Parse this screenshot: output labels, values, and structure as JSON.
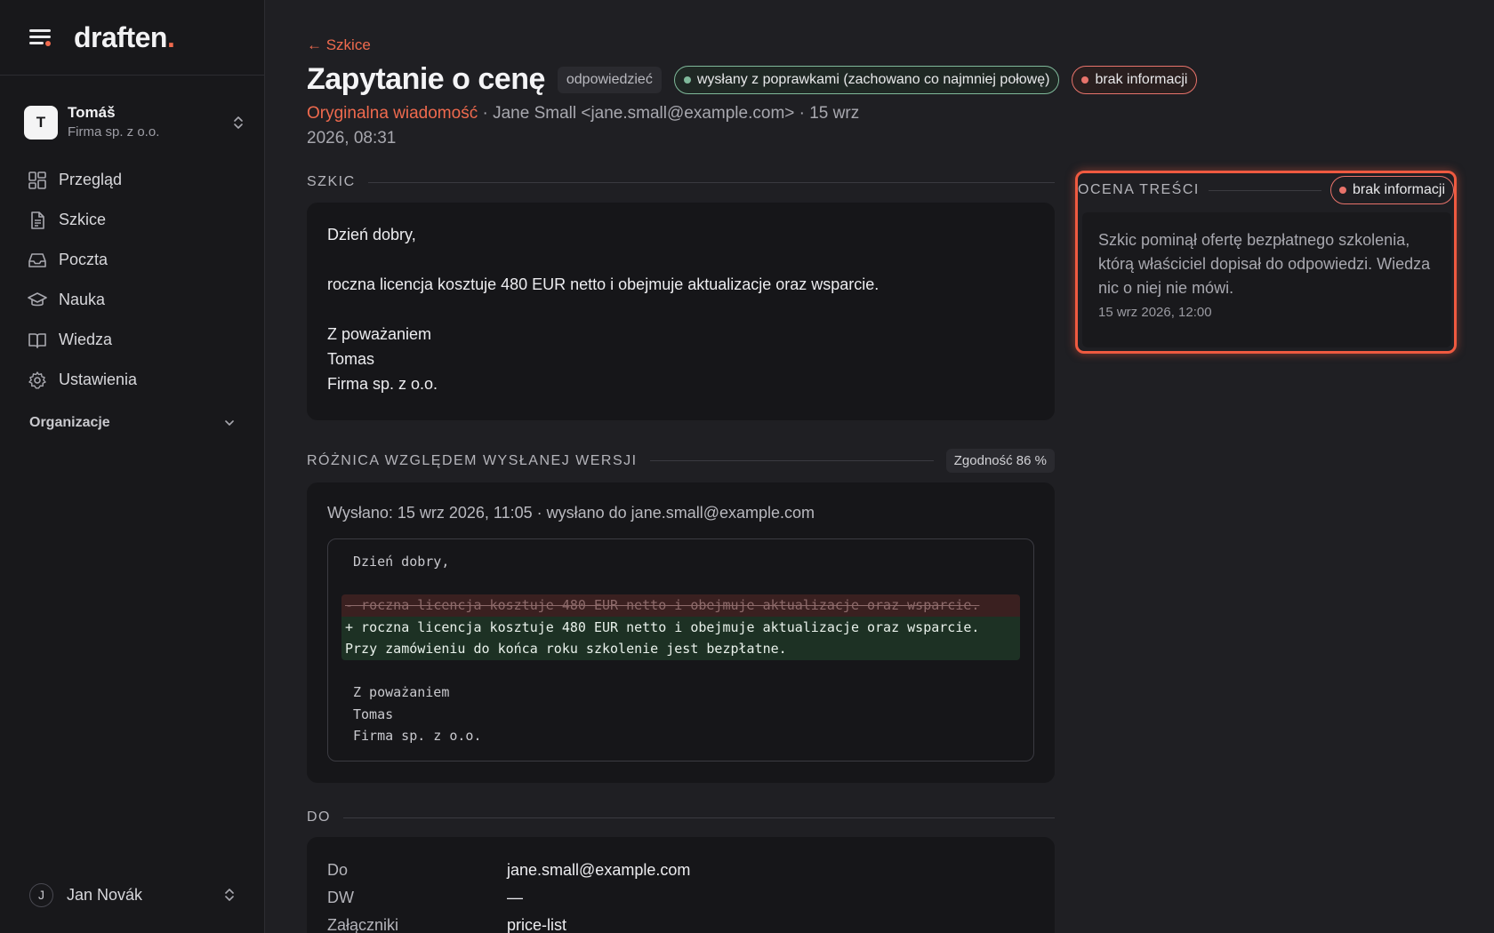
{
  "app": {
    "logo_text": "draften",
    "logo_dot": ".",
    "accent_color": "#ef6a4e"
  },
  "account": {
    "initial": "T",
    "name": "Tomáš",
    "org": "Firma sp. z o.o."
  },
  "sidebar": {
    "items": [
      {
        "label": "Przegląd",
        "icon": "grid-icon"
      },
      {
        "label": "Szkice",
        "icon": "document-icon"
      },
      {
        "label": "Poczta",
        "icon": "inbox-icon"
      },
      {
        "label": "Nauka",
        "icon": "graduation-cap-icon"
      },
      {
        "label": "Wiedza",
        "icon": "book-icon"
      },
      {
        "label": "Ustawienia",
        "icon": "gear-icon"
      }
    ],
    "organizations_label": "Organizacje"
  },
  "user": {
    "initial": "J",
    "name": "Jan Novák"
  },
  "header": {
    "back_label": "← Szkice",
    "title": "Zapytanie o cenę",
    "tag_type": "odpowiedzieć",
    "status_pill": "wysłany z poprawkami (zachowano co najmniej połowę)",
    "status_color": "#7fb99a",
    "info_pill": "brak informacji",
    "info_color": "#e8736b",
    "meta_original": "Oryginalna wiadomość",
    "meta_rest": " · Jane Small <jane.small@example.com> · 15 wrz 2026, 08:31"
  },
  "draft": {
    "section_title": "SZKIC",
    "lines": [
      "Dzień dobry,",
      "",
      "roczna licencja kosztuje 480 EUR netto i obejmuje aktualizacje oraz wsparcie.",
      "",
      "Z poważaniem",
      "Tomas",
      "Firma sp. z o.o."
    ]
  },
  "diff": {
    "section_title": "RÓŻNICA WZGLĘDEM WYSŁANEJ WERSJI",
    "match_badge": "Zgodność 86 %",
    "sent_info": "Wysłano: 15 wrz 2026, 11:05 · wysłano do jane.small@example.com",
    "line_greeting": "Dzień dobry,",
    "line_removed": "- roczna licencja kosztuje 480 EUR netto i obejmuje aktualizacje oraz wsparcie.",
    "line_added_1": "+ roczna licencja kosztuje 480 EUR netto i obejmuje aktualizacje oraz wsparcie.",
    "line_added_2": "Przy zamówieniu do końca roku szkolenie jest bezpłatne.",
    "line_sign_1": "Z poważaniem",
    "line_sign_2": "Tomas",
    "line_sign_3": "Firma sp. z o.o."
  },
  "recipients": {
    "section_title": "DO",
    "rows": [
      {
        "key": "Do",
        "value": "jane.small@example.com"
      },
      {
        "key": "DW",
        "value": "—"
      },
      {
        "key": "Załączniki",
        "value": "price-list"
      }
    ]
  },
  "evaluation": {
    "section_title": "OCENA TREŚCI",
    "pill": "brak informacji",
    "text": "Szkic pominął ofertę bezpłatnego szkolenia, którą właściciel dopisał do odpowiedzi. Wiedza nic o niej nie mówi.",
    "time": "15 wrz 2026, 12:00",
    "highlight_color": "#ef5a40"
  }
}
